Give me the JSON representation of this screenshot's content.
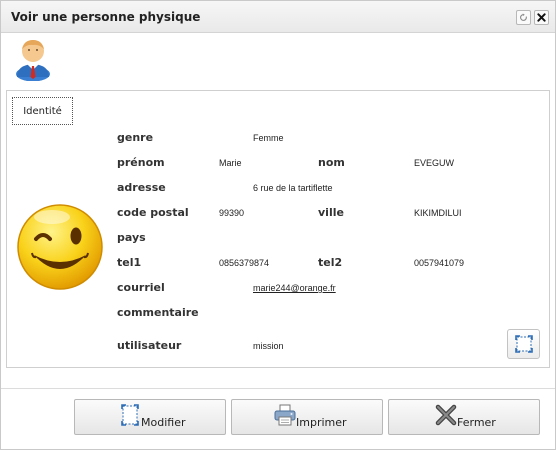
{
  "window": {
    "title": "Voir une personne physique"
  },
  "tabs": [
    {
      "label": "Identité"
    }
  ],
  "fields": {
    "genre": {
      "label": "genre",
      "value": "Femme"
    },
    "prenom": {
      "label": "prénom",
      "value": "Marie"
    },
    "nom": {
      "label": "nom",
      "value": "EVEGUW"
    },
    "adresse": {
      "label": "adresse",
      "value": "6 rue de la tartiflette"
    },
    "code_postal": {
      "label": "code postal",
      "value": "99390"
    },
    "ville": {
      "label": "ville",
      "value": "KIKIMDILUI"
    },
    "pays": {
      "label": "pays",
      "value": ""
    },
    "tel1": {
      "label": "tel1",
      "value": "0856379874"
    },
    "tel2": {
      "label": "tel2",
      "value": "0057941079"
    },
    "courriel": {
      "label": "courriel",
      "value": "marie244@orange.fr"
    },
    "commentaire": {
      "label": "commentaire",
      "value": ""
    },
    "utilisateur": {
      "label": "utilisateur",
      "value": "mission"
    }
  },
  "buttons": {
    "modifier": "Modifier",
    "imprimer": "Imprimer",
    "fermer": "Fermer"
  },
  "icons": {
    "titlebar": [
      "restore-icon",
      "close-icon"
    ],
    "header": "person-icon",
    "photo": "smiley-face-icon",
    "expand": "expand-icon",
    "modifier": "edit-icon",
    "imprimer": "printer-icon",
    "fermer": "close-x-icon"
  },
  "colors": {
    "smiley_yellow": "#f5c400",
    "titlebar_bg": "#eeeeee",
    "button_bg": "#f0f0f0"
  }
}
